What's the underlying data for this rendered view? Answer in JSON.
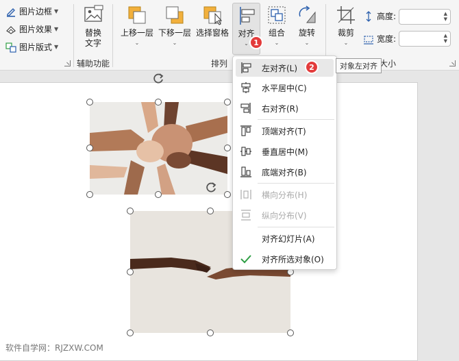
{
  "ribbon": {
    "picture_border": "图片边框",
    "picture_effects": "图片效果",
    "picture_layout": "图片版式",
    "alt_text": "替换\n文字",
    "alt_text_line1": "替换",
    "alt_text_line2": "文字",
    "accessibility_group": "辅助功能",
    "bring_forward": "上移一层",
    "send_backward": "下移一层",
    "selection_pane": "选择窗格",
    "align": "对齐",
    "arrange_group": "排列",
    "group": "组合",
    "rotate": "旋转",
    "crop": "裁剪",
    "height_label": "高度:",
    "width_label": "宽度:",
    "size_group_partial": "大小",
    "height_value": "",
    "width_value": ""
  },
  "badges": {
    "step1": "1",
    "step2": "2"
  },
  "menu": {
    "items": [
      {
        "label": "左对齐(L)",
        "icon": "align-left-icon",
        "enabled": true
      },
      {
        "label": "水平居中(C)",
        "icon": "align-center-icon",
        "enabled": true
      },
      {
        "label": "右对齐(R)",
        "icon": "align-right-icon",
        "enabled": true
      },
      {
        "label": "顶端对齐(T)",
        "icon": "align-top-icon",
        "enabled": true
      },
      {
        "label": "垂直居中(M)",
        "icon": "align-middle-icon",
        "enabled": true
      },
      {
        "label": "底端对齐(B)",
        "icon": "align-bottom-icon",
        "enabled": true
      },
      {
        "label": "横向分布(H)",
        "icon": "distribute-horizontal-icon",
        "enabled": false
      },
      {
        "label": "纵向分布(V)",
        "icon": "distribute-vertical-icon",
        "enabled": false
      },
      {
        "label": "对齐幻灯片(A)",
        "icon": "",
        "enabled": true
      },
      {
        "label": "对齐所选对象(O)",
        "icon": "checkmark-icon",
        "enabled": true
      }
    ]
  },
  "tooltip": "对象左对齐",
  "watermark": "软件自学网：RJZXW.COM",
  "colors": {
    "badge_red": "#e33b3b",
    "check_green": "#2e9e44",
    "icon_blue": "#2b5fad",
    "icon_orange": "#f2b03c"
  }
}
